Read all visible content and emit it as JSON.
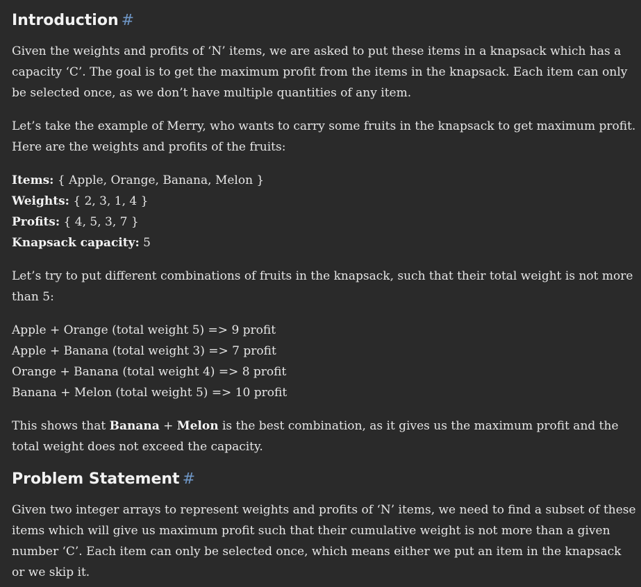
{
  "intro": {
    "heading": "Introduction",
    "anchor": "#",
    "para1": "Given the weights and profits of ‘N’ items, we are asked to put these items in a knapsack which has a capacity ‘C’. The goal is to get the maximum profit from the items in the knapsack. Each item can only be selected once, as we don’t have multiple quantities of any item.",
    "para2": "Let’s take the example of Merry, who wants to carry some fruits in the knapsack to get maximum profit. Here are the weights and profits of the fruits:",
    "items_label": "Items:",
    "items_value": "{ Apple, Orange, Banana, Melon }",
    "weights_label": "Weights:",
    "weights_value": "{ 2, 3, 1, 4 }",
    "profits_label": "Profits:",
    "profits_value": "{ 4, 5, 3, 7 }",
    "capacity_label": "Knapsack capacity:",
    "capacity_value": "5",
    "para3": "Let’s try to put different combinations of fruits in the knapsack, such that their total weight is not more than 5:",
    "combos": [
      "Apple + Orange (total weight 5) => 9 profit",
      "Apple + Banana (total weight 3) => 7 profit",
      "Orange + Banana (total weight 4) => 8 profit",
      "Banana + Melon (total weight 5) => 10 profit"
    ],
    "conclusion_prefix": "This shows that ",
    "conclusion_bold1": "Banana",
    "conclusion_plus": " + ",
    "conclusion_bold2": "Melon",
    "conclusion_suffix": " is the best combination, as it gives us the maximum profit and the total weight does not exceed the capacity."
  },
  "problem": {
    "heading": "Problem Statement",
    "anchor": "#",
    "para": "Given two integer arrays to represent weights and profits of ‘N’ items, we need to find a subset of these items which will give us maximum profit such that their cumulative weight is not more than a given number ‘C’. Each item can only be selected once, which means either we put an item in the knapsack or we skip it."
  }
}
